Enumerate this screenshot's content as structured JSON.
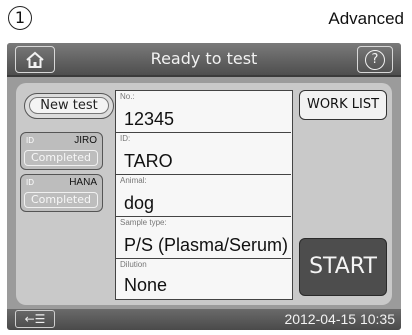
{
  "header": {
    "step_number": "1",
    "mode": "Advanced"
  },
  "topbar": {
    "title": "Ready to test",
    "home_icon": "home-icon",
    "help_icon": "help-icon",
    "help_glyph": "?"
  },
  "tabs": {
    "new_test_label": "New test"
  },
  "patients": [
    {
      "id_label": "ID",
      "name": "JIRO",
      "status": "Completed"
    },
    {
      "id_label": "ID",
      "name": "HANA",
      "status": "Completed"
    }
  ],
  "fields": [
    {
      "label": "No.:",
      "value": "12345"
    },
    {
      "label": "ID:",
      "value": "TARO"
    },
    {
      "label": "Animal:",
      "value": "dog"
    },
    {
      "label": "Sample type:",
      "value": "P/S (Plasma/Serum)"
    },
    {
      "label": "Dilution",
      "value": "None"
    }
  ],
  "buttons": {
    "worklist_label": "WORK LIST",
    "start_label": "START"
  },
  "footer": {
    "back_icon": "back-list-icon",
    "back_glyph": "←☰",
    "datetime": "2012-04-15 10:35"
  },
  "colors": {
    "bar_dark": "#4e4e4e",
    "panel_bg": "#c9c9c9",
    "device_bg": "#9b9b9b",
    "start_button": "#4d4d4d",
    "field_bg": "#f7f7f7"
  }
}
